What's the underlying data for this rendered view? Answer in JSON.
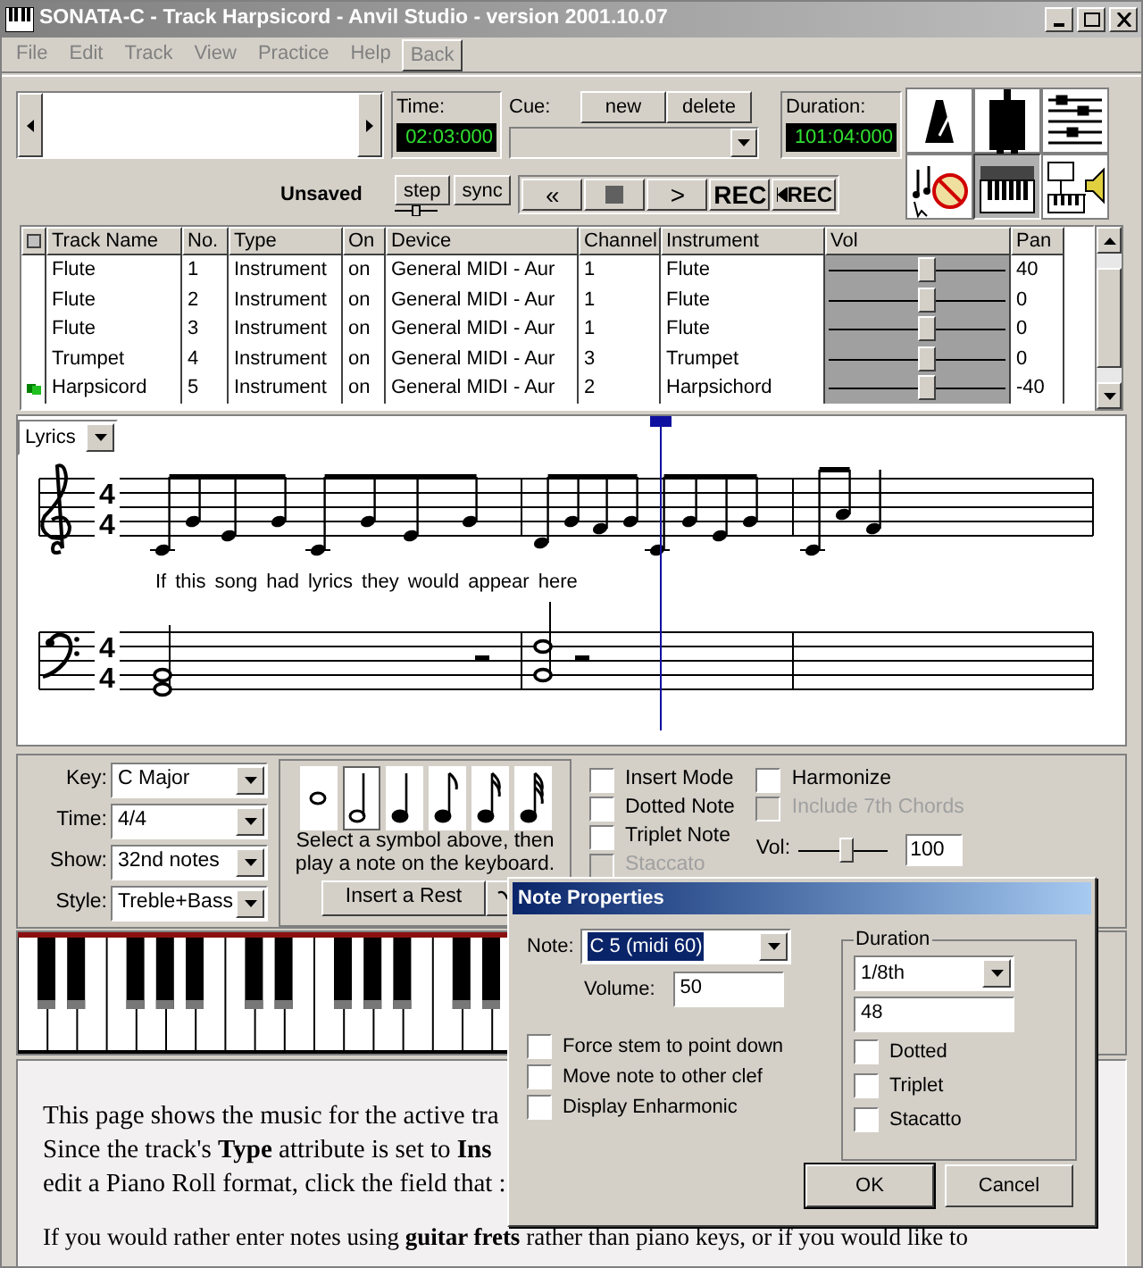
{
  "window": {
    "title": "SONATA-C - Track Harpsicord - Anvil Studio - version 2001.10.07"
  },
  "menu": [
    {
      "label": "File",
      "kind": "menu"
    },
    {
      "label": "Edit",
      "kind": "menu"
    },
    {
      "label": "Track",
      "kind": "menu"
    },
    {
      "label": "View",
      "kind": "menu"
    },
    {
      "label": "Practice",
      "kind": "menu"
    },
    {
      "label": "Help",
      "kind": "menu"
    },
    {
      "label": "Back",
      "kind": "button"
    }
  ],
  "toolbar": {
    "time": {
      "label": "Time:",
      "value": "02:03:000"
    },
    "cue": {
      "label": "Cue:",
      "buttons": [
        "new",
        "delete"
      ]
    },
    "duration": {
      "label": "Duration:",
      "value": "101:04:000"
    },
    "tools": [
      {
        "kind": "metronome",
        "selected": false
      },
      {
        "kind": "plug",
        "selected": false
      },
      {
        "kind": "mixer",
        "selected": false
      },
      {
        "kind": "no-notes",
        "selected": false
      },
      {
        "kind": "keyboard",
        "selected": true
      },
      {
        "kind": "keyboard-speaker",
        "selected": false
      }
    ]
  },
  "transport": {
    "status": "Unsaved",
    "modes": [
      "step",
      "sync"
    ],
    "tempo": {
      "level": 0.5
    },
    "buttons": [
      {
        "kind": "text",
        "label": "«"
      },
      {
        "kind": "stop"
      },
      {
        "kind": "text",
        "label": ">"
      },
      {
        "kind": "text",
        "label": "REC"
      },
      {
        "kind": "rec-start",
        "label": "REC"
      }
    ]
  },
  "tracks": {
    "columns": [
      "Track Name",
      "No.",
      "Type",
      "On",
      "Device",
      "Channel",
      "Instrument",
      "Vol",
      "Pan"
    ],
    "rows": [
      {
        "active": false,
        "name": "Flute",
        "no": "1",
        "type": "Instrument",
        "on": "on",
        "device": "General MIDI - Aur",
        "channel": "1",
        "instrument": "Flute",
        "level": 0.55,
        "pan": "40"
      },
      {
        "active": false,
        "name": "Flute",
        "no": "2",
        "type": "Instrument",
        "on": "on",
        "device": "General MIDI - Aur",
        "channel": "1",
        "instrument": "Flute",
        "level": 0.55,
        "pan": "0"
      },
      {
        "active": false,
        "name": "Flute",
        "no": "3",
        "type": "Instrument",
        "on": "on",
        "device": "General MIDI - Aur",
        "channel": "1",
        "instrument": "Flute",
        "level": 0.55,
        "pan": "0"
      },
      {
        "active": false,
        "name": "Trumpet",
        "no": "4",
        "type": "Instrument",
        "on": "on",
        "device": "General MIDI - Aur",
        "channel": "3",
        "instrument": "Trumpet",
        "level": 0.55,
        "pan": "0"
      },
      {
        "active": true,
        "name": "Harpsicord",
        "no": "5",
        "type": "Instrument",
        "on": "on",
        "device": "General MIDI - Aur",
        "channel": "2",
        "instrument": "Harpsichord",
        "level": 0.55,
        "pan": "-40"
      }
    ]
  },
  "score": {
    "view": "Lyrics",
    "treble_time": [
      "4",
      "4"
    ],
    "bass_time": [
      "4",
      "4"
    ],
    "lyrics": [
      "If",
      "this",
      "song",
      "had",
      "lyrics",
      "they",
      "would",
      "appear",
      "here"
    ]
  },
  "note_entry": {
    "selectors": [
      {
        "label": "Key:",
        "value": "C Major"
      },
      {
        "label": "Time:",
        "value": "4/4"
      },
      {
        "label": "Show:",
        "value": "32nd notes"
      },
      {
        "label": "Style:",
        "value": "Treble+Bass"
      }
    ],
    "symbols": [
      {
        "kind": "whole",
        "selected": false
      },
      {
        "kind": "half",
        "selected": true
      },
      {
        "kind": "quarter",
        "selected": false
      },
      {
        "kind": "eighth",
        "selected": false
      },
      {
        "kind": "sixteenth",
        "selected": false
      },
      {
        "kind": "thirty-second",
        "selected": false
      }
    ],
    "hint": "Select a symbol above, then play a note on the keyboard.",
    "rest_button": "Insert a Rest",
    "options": [
      {
        "label": "Insert Mode",
        "checked": false,
        "disabled": false
      },
      {
        "label": "Dotted Note",
        "checked": false,
        "disabled": false
      },
      {
        "label": "Triplet Note",
        "checked": false,
        "disabled": false
      },
      {
        "label": "Staccato",
        "checked": false,
        "disabled": true
      }
    ],
    "options_2": [
      {
        "label": "Harmonize",
        "checked": false,
        "disabled": false
      },
      {
        "label": "Include 7th Chords",
        "checked": false,
        "disabled": true
      }
    ],
    "volume": {
      "label": "Vol:",
      "level": 0.55,
      "value": "100"
    }
  },
  "help": {
    "lines": [
      "This page shows the music for the active tra",
      "Since the track's **Type** attribute is set to **Ins**",
      "edit a Piano Roll format, click the field that :"
    ],
    "last_line": "If you would rather enter notes using **guitar frets** rather than piano keys, or if you would like to"
  },
  "dialog": {
    "title": "Note Properties",
    "note": {
      "label": "Note:",
      "value": "C 5 (midi 60)"
    },
    "volume": {
      "label": "Volume:",
      "value": "50"
    },
    "options": [
      {
        "label": "Force stem to point down",
        "checked": false
      },
      {
        "label": "Move note to other clef",
        "checked": false
      },
      {
        "label": "Display Enharmonic",
        "checked": false
      }
    ],
    "duration": {
      "title": "Duration",
      "value": "1/8th",
      "ticks": "48",
      "options": [
        {
          "label": "Dotted",
          "checked": false
        },
        {
          "label": "Triplet",
          "checked": false
        },
        {
          "label": "Stacatto",
          "checked": false
        }
      ]
    },
    "buttons": [
      {
        "label": "OK",
        "default": true
      },
      {
        "label": "Cancel",
        "default": false
      }
    ]
  }
}
